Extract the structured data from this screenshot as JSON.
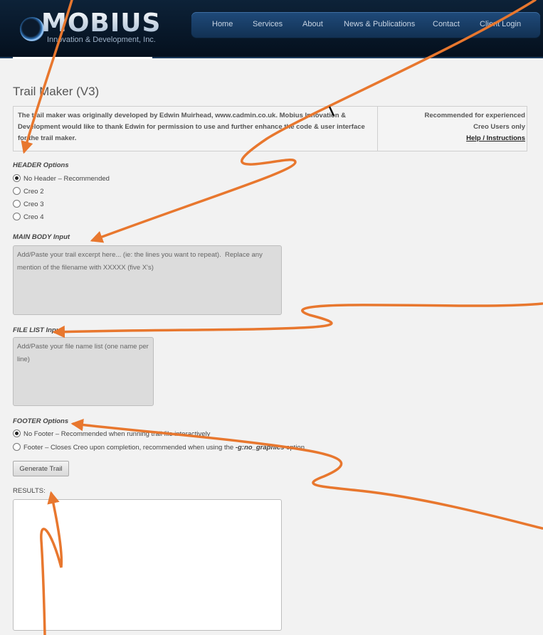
{
  "header": {
    "logo_text": "MOBIUS",
    "logo_subtitle": "Innovation & Development, Inc.",
    "nav": [
      "Home",
      "Services",
      "About",
      "News & Publications",
      "Contact",
      "Client Login"
    ]
  },
  "page": {
    "title": "Trail Maker (V3)"
  },
  "intro": {
    "text": "The trail maker was originally developed by Edwin Muirhead, www.cadmin.co.uk. Mobius Innovation & Development would like to thank Edwin for permission to use and further enhance the code & user interface for the trail maker.",
    "recommend_line1": "Recommended for experienced",
    "recommend_line2": "Creo Users only",
    "help_link": "Help / Instructions"
  },
  "header_options": {
    "label": "HEADER Options",
    "options": [
      "No Header – Recommended",
      "Creo 2",
      "Creo 3",
      "Creo 4"
    ],
    "selected": "No Header – Recommended"
  },
  "main_body": {
    "label": "MAIN BODY Input",
    "placeholder": "Add/Paste your trail excerpt here... (ie: the lines you want to repeat).  Replace any mention of the filename with XXXXX (five X's)"
  },
  "file_list": {
    "label": "FILE LIST Input",
    "placeholder": "Add/Paste your file name list (one name per line)"
  },
  "footer_options": {
    "label": "FOOTER Options",
    "option1": "No Footer – Recommended when running trail file interactively",
    "option2_prefix": "Footer – Closes Creo upon completion, recommended when using the ",
    "option2_flag": "-g:no_graphics",
    "option2_suffix": " option",
    "selected": "No Footer – Recommended when running trail file interactively"
  },
  "generate_button": "Generate Trail",
  "results": {
    "label": "RESULTS:"
  },
  "annotation_color": "#e8772e"
}
